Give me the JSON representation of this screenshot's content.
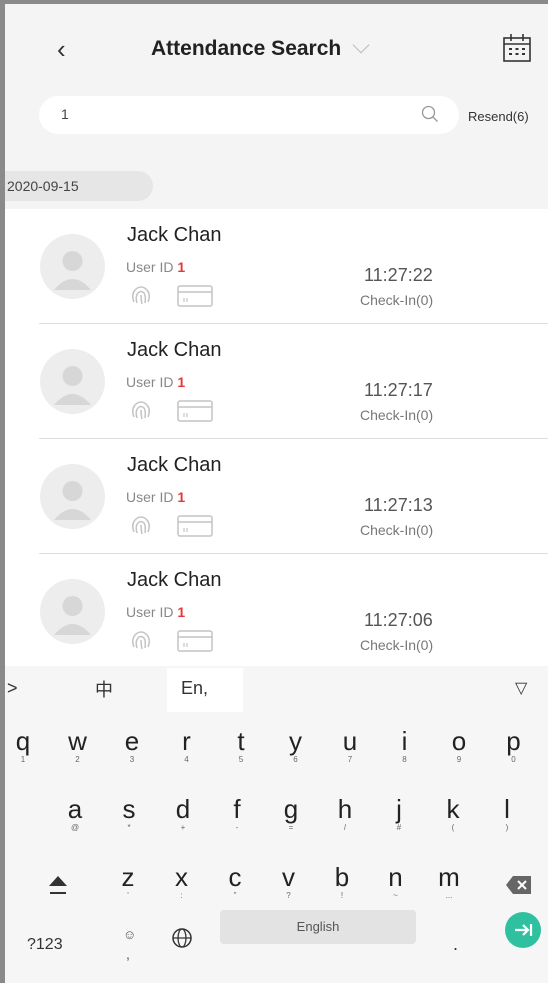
{
  "header": {
    "title": "Attendance Search"
  },
  "search": {
    "value": "1",
    "resend_label": "Resend(6)"
  },
  "date": "2020-09-15",
  "records": [
    {
      "name": "Jack Chan",
      "user_id_label": "User ID",
      "user_id": "1",
      "time": "11:27:22",
      "state": "Check-In(0)"
    },
    {
      "name": "Jack Chan",
      "user_id_label": "User ID",
      "user_id": "1",
      "time": "11:27:17",
      "state": "Check-In(0)"
    },
    {
      "name": "Jack Chan",
      "user_id_label": "User ID",
      "user_id": "1",
      "time": "11:27:13",
      "state": "Check-In(0)"
    },
    {
      "name": "Jack Chan",
      "user_id_label": "User ID",
      "user_id": "1",
      "time": "11:27:06",
      "state": "Check-In(0)"
    }
  ],
  "keyboard": {
    "lang_cn": "中",
    "lang_en": "En,",
    "expand": ">",
    "collapse": "▽",
    "row1": [
      {
        "k": "q",
        "s": "1"
      },
      {
        "k": "w",
        "s": "2"
      },
      {
        "k": "e",
        "s": "3"
      },
      {
        "k": "r",
        "s": "4"
      },
      {
        "k": "t",
        "s": "5"
      },
      {
        "k": "y",
        "s": "6"
      },
      {
        "k": "u",
        "s": "7"
      },
      {
        "k": "i",
        "s": "8"
      },
      {
        "k": "o",
        "s": "9"
      },
      {
        "k": "p",
        "s": "0"
      }
    ],
    "row2": [
      {
        "k": "a",
        "s": "@"
      },
      {
        "k": "s",
        "s": "*"
      },
      {
        "k": "d",
        "s": "+"
      },
      {
        "k": "f",
        "s": "-"
      },
      {
        "k": "g",
        "s": "="
      },
      {
        "k": "h",
        "s": "/"
      },
      {
        "k": "j",
        "s": "#"
      },
      {
        "k": "k",
        "s": "("
      },
      {
        "k": "l",
        "s": ")"
      }
    ],
    "row3": [
      {
        "k": "z",
        "s": "'"
      },
      {
        "k": "x",
        "s": ":"
      },
      {
        "k": "c",
        "s": "\""
      },
      {
        "k": "v",
        "s": "?"
      },
      {
        "k": "b",
        "s": "!"
      },
      {
        "k": "n",
        "s": "~"
      },
      {
        "k": "m",
        "s": "..."
      }
    ],
    "symbols": "?123",
    "space": "English",
    "period": ".",
    "comma": ","
  },
  "colors": {
    "accent": "#2fc0a0",
    "user_id_num": "#e03a3a"
  },
  "icons": [
    "back-icon",
    "chevron-down-icon",
    "calendar-icon",
    "search-icon",
    "avatar-icon",
    "fingerprint-icon",
    "card-icon",
    "shift-icon",
    "backspace-icon",
    "emoji-icon",
    "globe-icon",
    "enter-icon"
  ]
}
